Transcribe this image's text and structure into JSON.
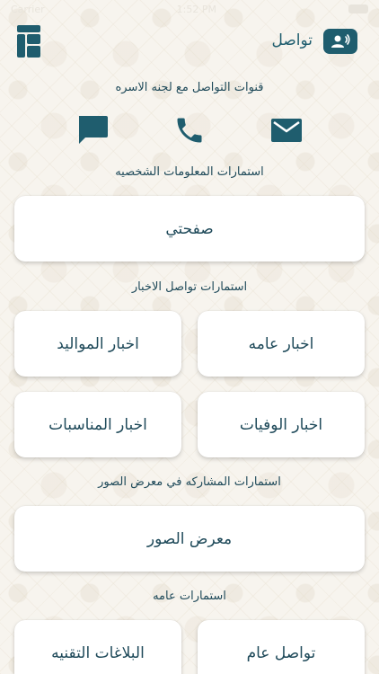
{
  "status_bar": {
    "carrier": "Carrier",
    "time": "1:52 PM"
  },
  "header": {
    "title": "تواصل",
    "contact_icon": "contact-support-icon",
    "logo": "app-logo-icon"
  },
  "sections": {
    "channels_title": "قنوات التواصل مع لجنه الاسره",
    "personal_title": "استمارات المعلومات الشخصيه",
    "news_title": "استمارات تواصل الاخبار",
    "gallery_title": "استمارات المشاركه في معرض الصور",
    "general_title": "استمارات عامه"
  },
  "channels": [
    {
      "name": "email",
      "icon": "mail-icon"
    },
    {
      "name": "phone",
      "icon": "phone-icon"
    },
    {
      "name": "chat",
      "icon": "chat-icon"
    }
  ],
  "buttons": {
    "my_page": "صفحتي",
    "general_news": "اخبار عامه",
    "births_news": "اخبار المواليد",
    "deaths_news": "اخبار الوفيات",
    "events_news": "اخبار المناسبات",
    "photo_gallery": "معرض الصور",
    "general_contact": "تواصل عام",
    "technical_reports": "البلاغات التقنيه"
  },
  "colors": {
    "primary": "#1f5d6e",
    "text": "#1f4a5a",
    "background": "#f7f4ee",
    "card": "#ffffff"
  }
}
